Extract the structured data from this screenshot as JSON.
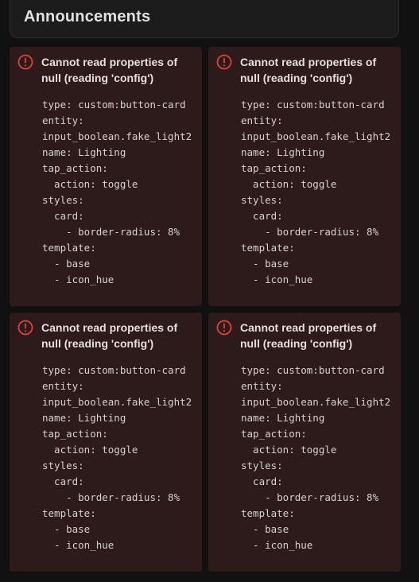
{
  "header": {
    "title": "Announcements"
  },
  "colors": {
    "background": "#111111",
    "card_background": "#2d1b1b",
    "error_red": "#db4437",
    "text": "#e6dede"
  },
  "error_cards": [
    {
      "icon": "alert-circle-icon",
      "message": "Cannot read properties of null (reading 'config')",
      "config_lines": [
        "type: custom:button-card",
        "entity:",
        "input_boolean.fake_light2",
        "name: Lighting",
        "tap_action:",
        "  action: toggle",
        "styles:",
        "  card:",
        "    - border-radius: 8%",
        "template:",
        "  - base",
        "  - icon_hue"
      ]
    },
    {
      "icon": "alert-circle-icon",
      "message": "Cannot read properties of null (reading 'config')",
      "config_lines": [
        "type: custom:button-card",
        "entity:",
        "input_boolean.fake_light2",
        "name: Lighting",
        "tap_action:",
        "  action: toggle",
        "styles:",
        "  card:",
        "    - border-radius: 8%",
        "template:",
        "  - base",
        "  - icon_hue"
      ]
    },
    {
      "icon": "alert-circle-icon",
      "message": "Cannot read properties of null (reading 'config')",
      "config_lines": [
        "type: custom:button-card",
        "entity:",
        "input_boolean.fake_light2",
        "name: Lighting",
        "tap_action:",
        "  action: toggle",
        "styles:",
        "  card:",
        "    - border-radius: 8%",
        "template:",
        "  - base",
        "  - icon_hue"
      ]
    },
    {
      "icon": "alert-circle-icon",
      "message": "Cannot read properties of null (reading 'config')",
      "config_lines": [
        "type: custom:button-card",
        "entity:",
        "input_boolean.fake_light2",
        "name: Lighting",
        "tap_action:",
        "  action: toggle",
        "styles:",
        "  card:",
        "    - border-radius: 8%",
        "template:",
        "  - base",
        "  - icon_hue"
      ]
    }
  ]
}
